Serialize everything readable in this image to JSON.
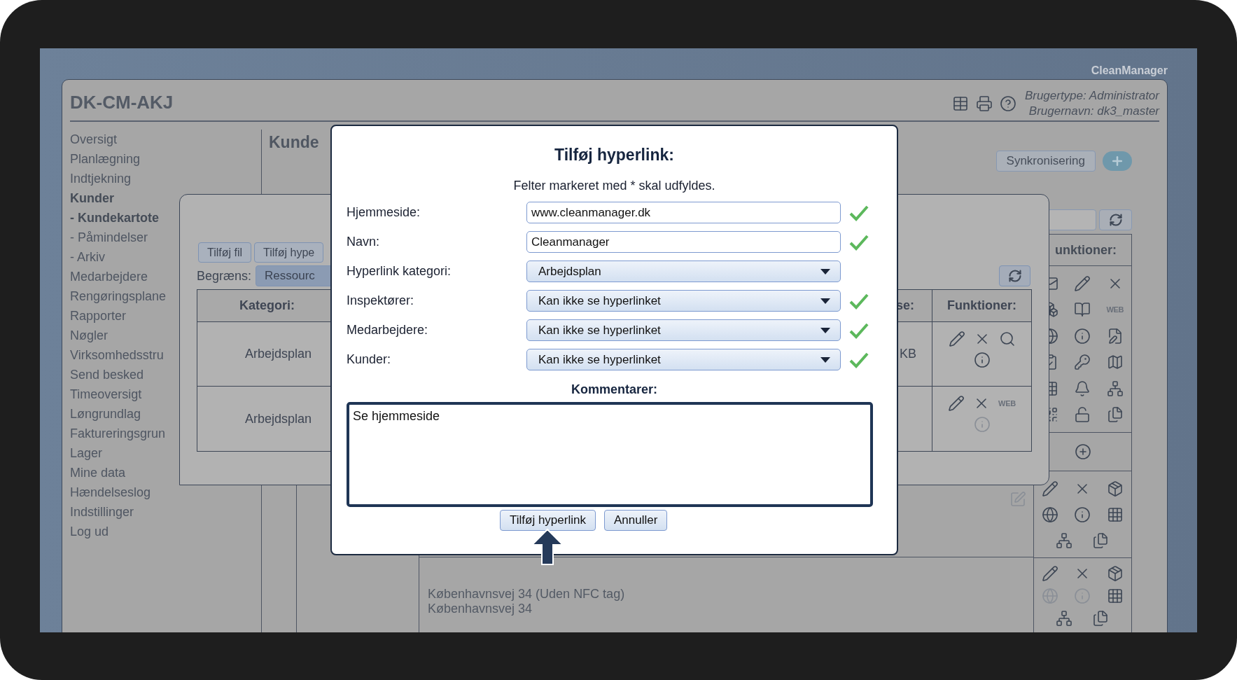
{
  "brand": "CleanManager",
  "app": {
    "title": "DK-CM-AKJ",
    "user_type": "Brugertype: Administrator",
    "user_name": "Brugernavn: dk3_master"
  },
  "sidebar": {
    "items": [
      {
        "label": "Oversigt",
        "selected": false
      },
      {
        "label": "Planlægning",
        "selected": false
      },
      {
        "label": "Indtjekning",
        "selected": false
      },
      {
        "label": "Kunder",
        "selected": true,
        "children": [
          {
            "label": "- Kundekartote",
            "selected": true
          },
          {
            "label": "- Påmindelser",
            "selected": false
          },
          {
            "label": "- Arkiv",
            "selected": false
          }
        ]
      },
      {
        "label": "Medarbejdere",
        "selected": false
      },
      {
        "label": "Rengøringsplane",
        "selected": false
      },
      {
        "label": "Rapporter",
        "selected": false
      },
      {
        "label": "Nøgler",
        "selected": false
      },
      {
        "label": "Virksomhedsstru",
        "selected": false
      },
      {
        "label": "Send besked",
        "selected": false
      },
      {
        "label": "Timeoversigt",
        "selected": false
      },
      {
        "label": "Løngrundlag",
        "selected": false
      },
      {
        "label": "Faktureringsgrun",
        "selected": false
      },
      {
        "label": "Lager",
        "selected": false
      },
      {
        "label": "Mine data",
        "selected": false
      },
      {
        "label": "Hændelseslog",
        "selected": false
      },
      {
        "label": "Indstillinger",
        "selected": false
      },
      {
        "label": "Log ud",
        "selected": false
      }
    ]
  },
  "content": {
    "heading": "Kunde",
    "sync_button": "Synkronisering",
    "functions_header": "unktioner:",
    "web_label": "WEB",
    "rows": [
      {
        "links_active": true
      },
      {
        "links_active": false
      }
    ],
    "addresses": [
      "Københavnsvej 34 (Uden NFC tag)",
      "Københavnsvej 34"
    ]
  },
  "files_dialog": {
    "buttons": [
      "Tilføj fil",
      "Tilføj hype"
    ],
    "filter_label": "Begræns:",
    "filter_button": "Ressourc",
    "columns": [
      "Kategori:",
      "se:",
      "Funktioner:"
    ],
    "rows": [
      {
        "kind": "file",
        "category": "Arbejdsplan",
        "column_3": "KB",
        "info_active": true
      },
      {
        "kind": "link",
        "category": "Arbejdsplan",
        "web_label": "WEB",
        "info_active": false
      }
    ]
  },
  "modal": {
    "title": "Tilføj hyperlink:",
    "note": "Felter markeret med * skal udfyldes.",
    "fields": [
      {
        "kind": "text",
        "label": "Hjemmeside:",
        "value": "www.cleanmanager.dk",
        "valid": true
      },
      {
        "kind": "text",
        "label": "Navn:",
        "value": "Cleanmanager",
        "valid": true
      },
      {
        "kind": "select",
        "label": "Hyperlink kategori:",
        "value": "Arbejdsplan",
        "valid": false
      },
      {
        "kind": "select",
        "label": "Inspektører:",
        "value": "Kan ikke se hyperlinket",
        "valid": true
      },
      {
        "kind": "select",
        "label": "Medarbejdere:",
        "value": "Kan ikke se hyperlinket",
        "valid": true
      },
      {
        "kind": "select",
        "label": "Kunder:",
        "value": "Kan ikke se hyperlinket",
        "valid": true
      }
    ],
    "comment_label": "Kommentarer:",
    "comment": "Se hjemmeside",
    "buttons": [
      {
        "label": "Tilføj hyperlink",
        "pointed": true
      },
      {
        "label": "Annuller",
        "pointed": false
      }
    ]
  }
}
